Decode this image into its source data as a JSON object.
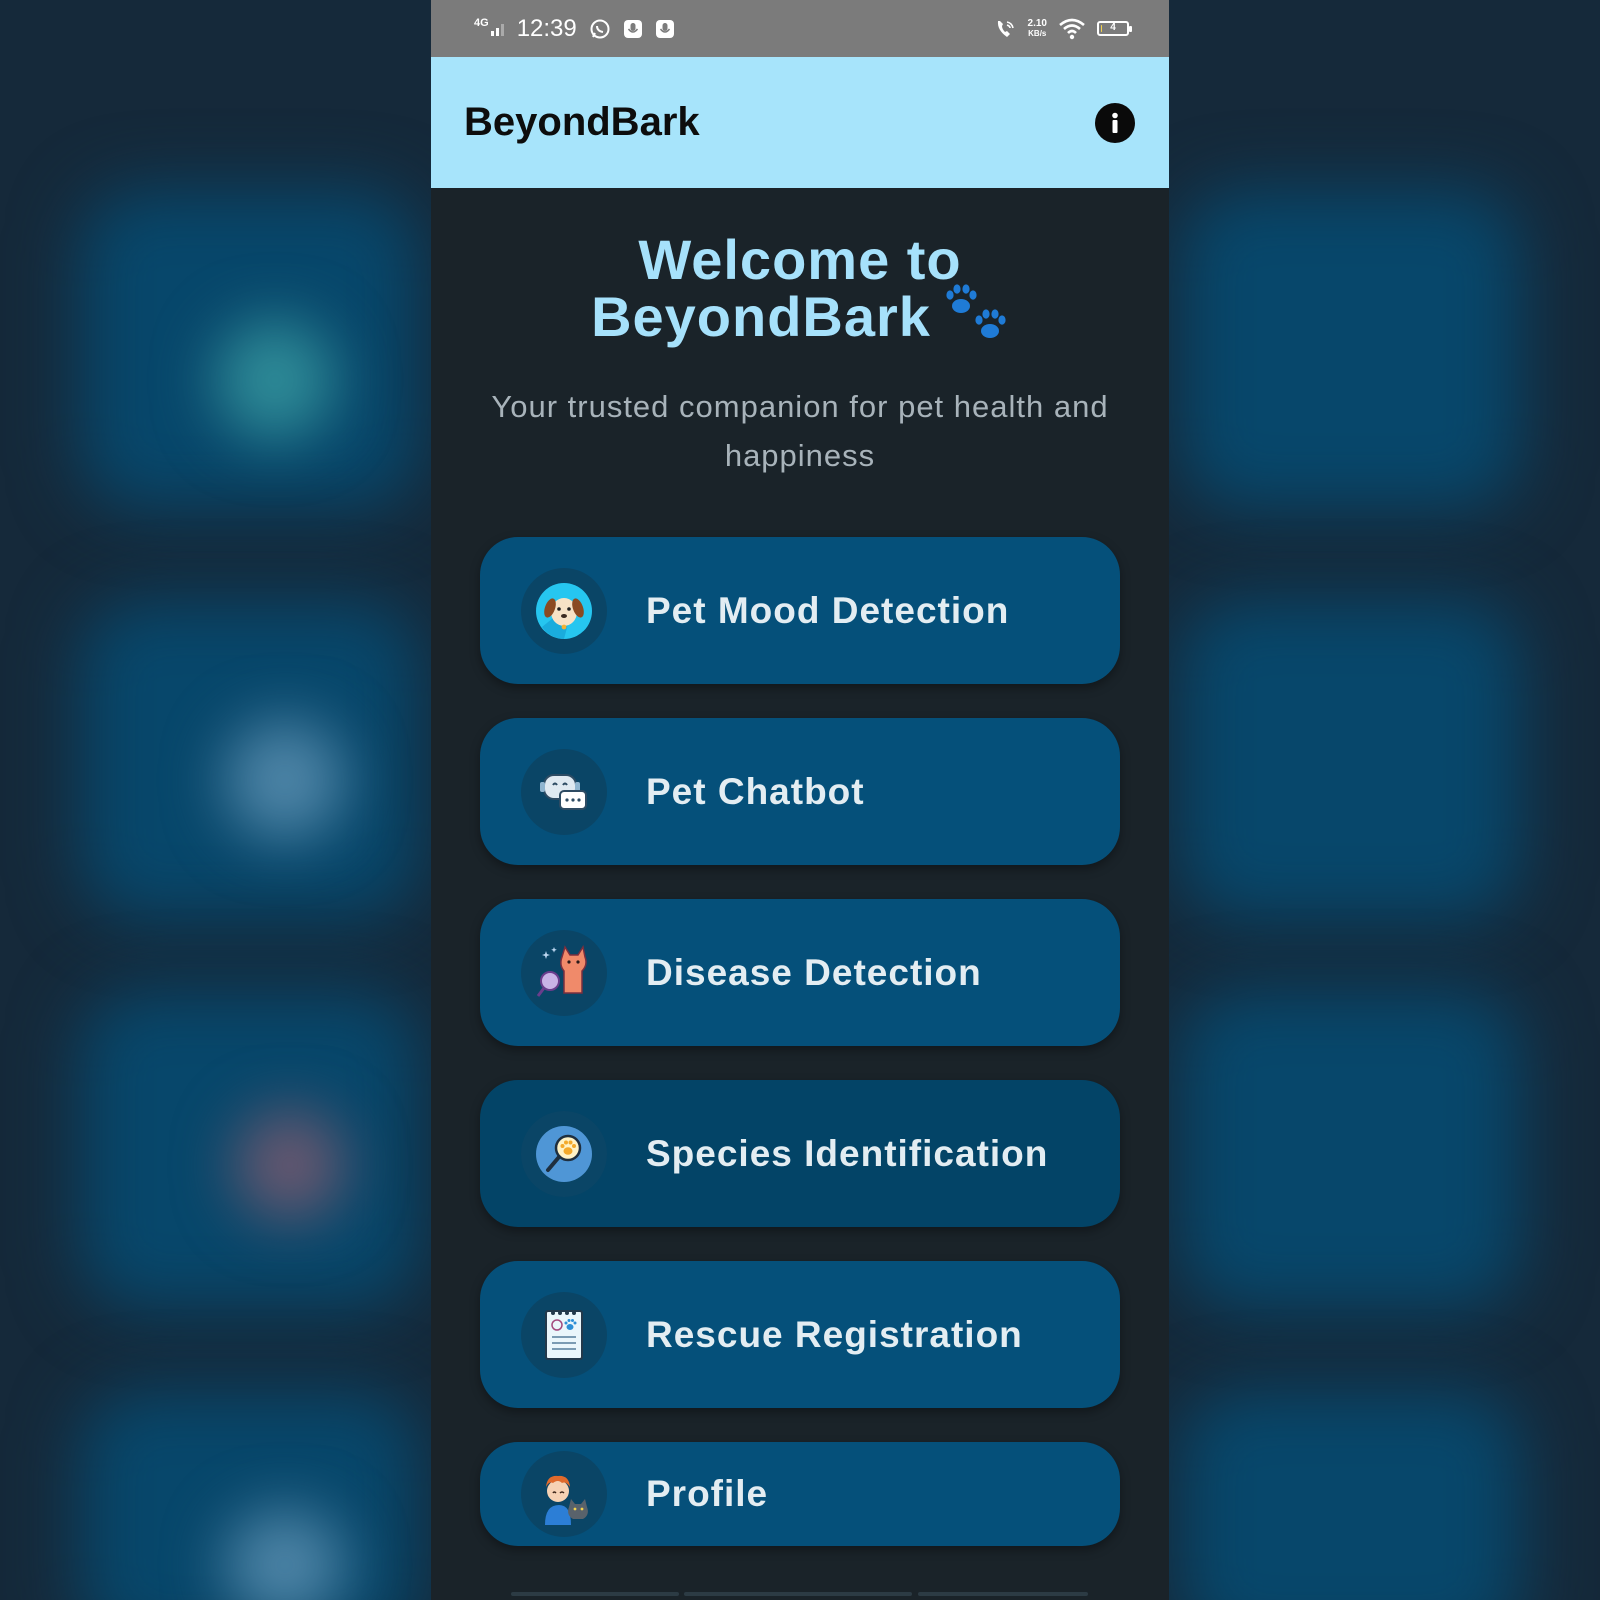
{
  "status_bar": {
    "network": "4G",
    "time": "12:39",
    "speed_value": "2.10",
    "speed_unit": "KB/s",
    "battery_level": "4"
  },
  "app_bar": {
    "title": "BeyondBark"
  },
  "hero": {
    "title_line1": "Welcome to",
    "title_line2": "BeyondBark",
    "subtitle": "Your trusted companion for pet health and happiness"
  },
  "menu": {
    "items": [
      {
        "label": "Pet Mood Detection",
        "icon": "dog-face-icon"
      },
      {
        "label": "Pet Chatbot",
        "icon": "chatbot-icon"
      },
      {
        "label": "Disease Detection",
        "icon": "cat-magnifier-icon"
      },
      {
        "label": "Species Identification",
        "icon": "paw-magnifier-icon"
      },
      {
        "label": "Rescue Registration",
        "icon": "notepad-paw-icon"
      },
      {
        "label": "Profile",
        "icon": "person-with-cat-icon"
      }
    ]
  },
  "colors": {
    "app_bar": "#a7e4fb",
    "card": "#05507a",
    "hero_title": "#a6e1fb",
    "paws": "#1f7bd6"
  }
}
